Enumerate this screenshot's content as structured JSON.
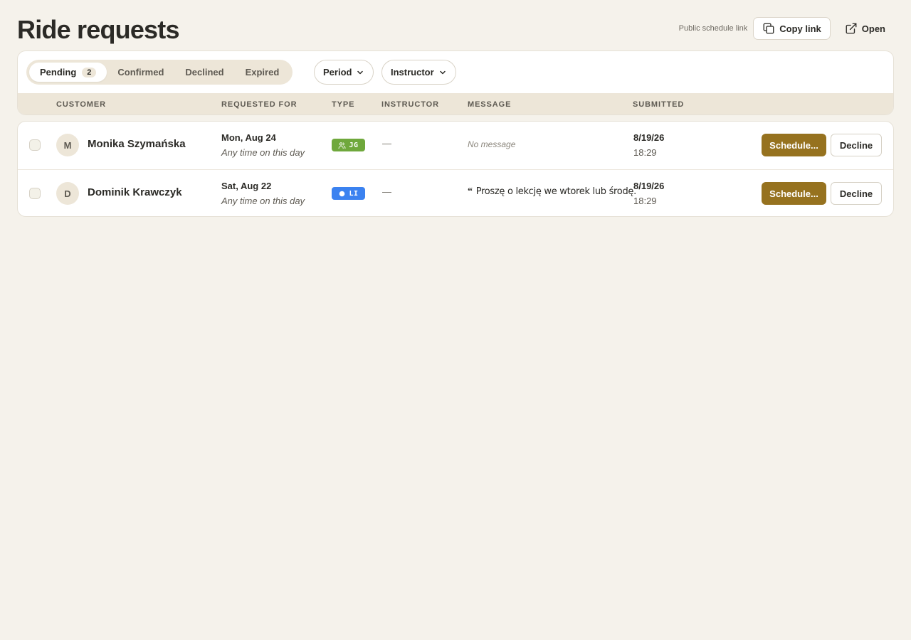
{
  "page": {
    "title": "Ride requests"
  },
  "header": {
    "public_link_label": "Public schedule link",
    "copy_link_label": "Copy link",
    "open_label": "Open"
  },
  "filters": {
    "tabs": [
      {
        "label": "Pending",
        "count": "2",
        "active": true
      },
      {
        "label": "Confirmed"
      },
      {
        "label": "Declined"
      },
      {
        "label": "Expired"
      }
    ],
    "period_label": "Period",
    "instructor_label": "Instructor"
  },
  "table": {
    "columns": [
      "CUSTOMER",
      "REQUESTED FOR",
      "TYPE",
      "INSTRUCTOR",
      "MESSAGE",
      "SUBMITTED"
    ],
    "rows": [
      {
        "avatar_initial": "M",
        "customer": "Monika Szymańska",
        "requested_date": "Mon, Aug 24",
        "requested_time": "Any time on this day",
        "type_code": "JG",
        "type_color": "#6fa83c",
        "type_icon": "users-icon",
        "instructor": "—",
        "message": "No message",
        "submitted_date": "8/19/26",
        "submitted_time": "18:29",
        "schedule_label": "Schedule...",
        "decline_label": "Decline"
      },
      {
        "avatar_initial": "D",
        "customer": "Dominik Krawczyk",
        "requested_date": "Sat, Aug 22",
        "requested_time": "Any time on this day",
        "type_code": "LI",
        "type_color": "#3b82f0",
        "type_icon": "circle-icon",
        "instructor": "—",
        "quote_mark": "“",
        "message": "Proszę o lekcję we wtorek lub środę.",
        "submitted_date": "8/19/26",
        "submitted_time": "18:29",
        "schedule_label": "Schedule...",
        "decline_label": "Decline"
      }
    ]
  },
  "colors": {
    "background": "#f5f2eb",
    "accent": "#96721f",
    "tab_bg": "#ede6d8"
  }
}
